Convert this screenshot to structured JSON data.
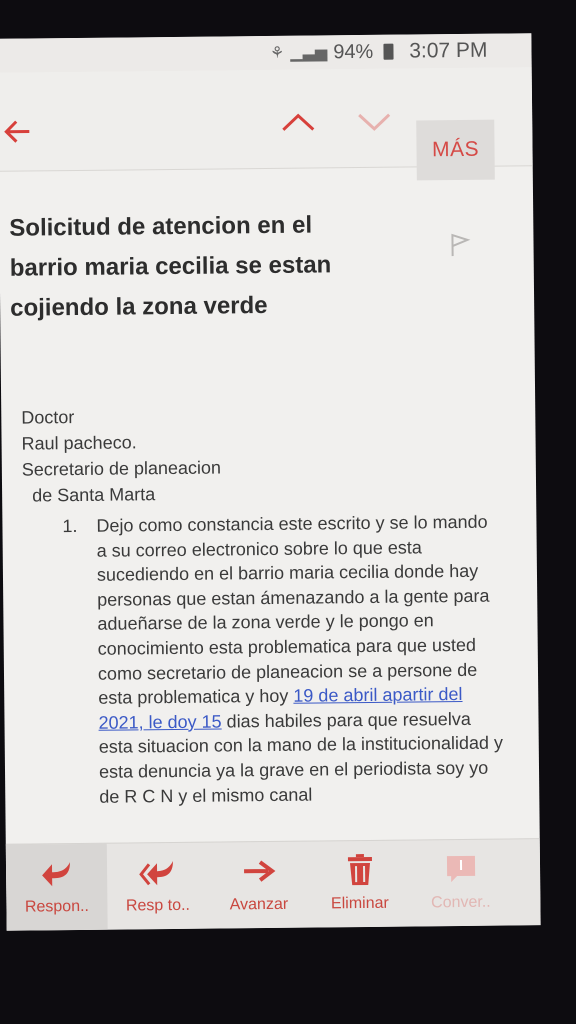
{
  "status_bar": {
    "battery": "94%",
    "time": "3:07 PM"
  },
  "action_bar": {
    "back_icon": "arrow-left-icon",
    "up_icon": "chevron-up-icon",
    "down_icon": "chevron-down-icon",
    "more_label": "MÁS"
  },
  "email": {
    "subject_lines": [
      "Solicitud de atencion en el",
      "barrio maria cecilia se estan",
      "cojiendo la zona verde"
    ],
    "greeting": [
      "Doctor",
      "Raul pacheco.",
      "Secretario de planeacion",
      "de Santa Marta"
    ],
    "item_number": "1.",
    "body_part1": "Dejo como constancia este escrito y se lo mando a su correo electronico sobre lo que esta sucediendo  en el barrio maria cecilia donde hay  personas que estan ámenazando a la gente para adueñarse de la zona verde y le pongo en conocimiento esta problematica para que usted como secretario de planeacion se a persone de esta problematica y hoy ",
    "body_link": "19 de abril apartir del 2021, le doy 15",
    "body_part2": " dias habiles para que resuelva esta situacion con la mano de la institucionalidad y esta denuncia ya la grave en el periodista soy yo de R C N y el mismo canal"
  },
  "bottom_bar": {
    "reply_label": "Respon..",
    "reply_all_label": "Resp to..",
    "forward_label": "Avanzar",
    "delete_label": "Eliminar",
    "convert_label": "Conver.."
  },
  "colors": {
    "accent": "#d54a46",
    "link": "#3b59c6"
  }
}
